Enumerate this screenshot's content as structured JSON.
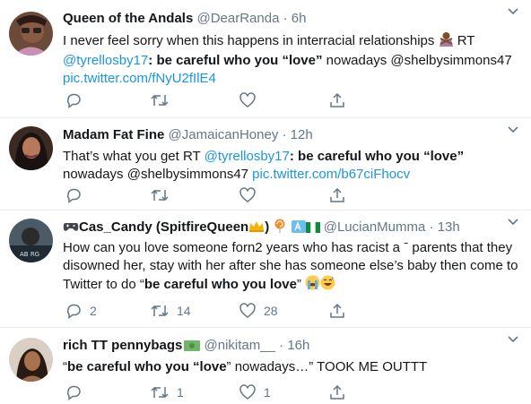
{
  "tweets": [
    {
      "name": "Queen of the Andals",
      "handle": "@DearRanda",
      "time": "6h",
      "line1_pre": "I never feel sorry when this happens in interracial relationships ",
      "line1_post": " RT",
      "mention": "@tyrellosby17",
      "bold1": "be careful who you “love”",
      "line2_post": " nowadays ",
      "mention2": "@shelbysimmons47",
      "link": "pic.twitter.com/fNyU2fIlE4",
      "reply_count": "",
      "retweet_count": "",
      "like_count": ""
    },
    {
      "name": "Madam Fat Fine",
      "handle": "@JamaicanHoney",
      "time": "12h",
      "line1_pre": "That’s what you get  RT ",
      "mention": "@tyrellosby17",
      "bold1": "be careful who you “love”",
      "line2_pre": "nowadays ",
      "mention2": "@shelbysimmons47",
      "link": "pic.twitter.com/b67ciFhocv",
      "reply_count": "",
      "retweet_count": "",
      "like_count": ""
    },
    {
      "name": "\u0001F3AECas_Candy (SpitfireQueen",
      "name_display": "Cas_Candy (SpitfireQueen",
      "name_close": ")",
      "handle": "@LucianMumma",
      "time": "13h",
      "line1": "How can you love someone forn2 years who has racist a  ˉ parents that they",
      "line2": "disowned her, stay with her after she has someone else’s baby then come to",
      "line3_pre": "Twitter to do “",
      "bold1": "be careful who you love",
      "line3_post": "” ",
      "reply_count": "2",
      "retweet_count": "14",
      "like_count": "28"
    },
    {
      "name": "rich TT pennybags",
      "handle": "@nikitam__",
      "time": "16h",
      "line1_pre": "“",
      "bold1": "be careful who you “love",
      "line1_post": "” nowadays…” TOOK ME OUTTT",
      "reply_count": "",
      "retweet_count": "1",
      "like_count": "1"
    }
  ],
  "icons": {
    "reply": "reply-icon",
    "retweet": "retweet-icon",
    "like": "heart-icon",
    "share": "share-icon",
    "caret": "chevron-down-icon"
  },
  "colors": {
    "text": "#14171a",
    "secondary": "#657786",
    "link": "#1b95e0",
    "divider": "#e6ecf0"
  }
}
